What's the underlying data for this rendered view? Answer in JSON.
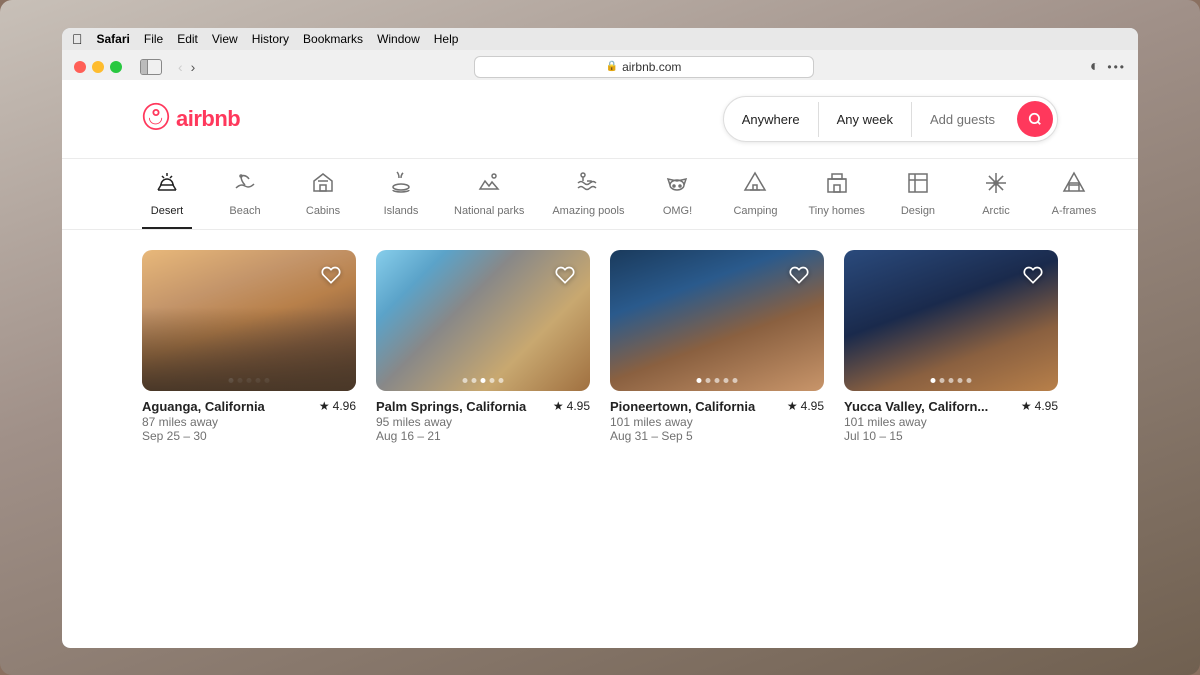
{
  "browser": {
    "url": "airbnb.com",
    "menu_items": [
      "Safari",
      "File",
      "Edit",
      "View",
      "History",
      "Bookmarks",
      "Window",
      "Help"
    ]
  },
  "header": {
    "logo_text": "airbnb",
    "search": {
      "location": "Anywhere",
      "dates": "Any week",
      "guests": "Add guests"
    }
  },
  "categories": [
    {
      "id": "desert",
      "label": "Desert",
      "icon": "🌵",
      "active": true
    },
    {
      "id": "beach",
      "label": "Beach",
      "icon": "⛱",
      "active": false
    },
    {
      "id": "cabins",
      "label": "Cabins",
      "icon": "🏠",
      "active": false
    },
    {
      "id": "islands",
      "label": "Islands",
      "icon": "🏝",
      "active": false
    },
    {
      "id": "national-parks",
      "label": "National parks",
      "icon": "⛺",
      "active": false
    },
    {
      "id": "amazing-pools",
      "label": "Amazing pools",
      "icon": "🏊",
      "active": false
    },
    {
      "id": "omg",
      "label": "OMG!",
      "icon": "🛸",
      "active": false
    },
    {
      "id": "camping",
      "label": "Camping",
      "icon": "🏕",
      "active": false
    },
    {
      "id": "tiny-homes",
      "label": "Tiny homes",
      "icon": "📊",
      "active": false
    },
    {
      "id": "design",
      "label": "Design",
      "icon": "🏛",
      "active": false
    },
    {
      "id": "arctic",
      "label": "Arctic",
      "icon": "❄",
      "active": false
    },
    {
      "id": "a-frames",
      "label": "A-frames",
      "icon": "🔺",
      "active": false
    }
  ],
  "listings": [
    {
      "id": 1,
      "location": "Aguanga, California",
      "distance": "87 miles away",
      "dates": "Sep 25 – 30",
      "rating": "4.96",
      "image_type": "desert1",
      "dots": 5,
      "active_dot": 0
    },
    {
      "id": 2,
      "location": "Palm Springs, California",
      "distance": "95 miles away",
      "dates": "Aug 16 – 21",
      "rating": "4.95",
      "image_type": "desert2",
      "dots": 5,
      "active_dot": 2
    },
    {
      "id": 3,
      "location": "Pioneertown, California",
      "distance": "101 miles away",
      "dates": "Aug 31 – Sep 5",
      "rating": "4.95",
      "image_type": "desert3",
      "dots": 5,
      "active_dot": 0
    },
    {
      "id": 4,
      "location": "Yucca Valley, Californ...",
      "distance": "101 miles away",
      "dates": "Jul 10 – 15",
      "rating": "4.95",
      "image_type": "desert4",
      "dots": 5,
      "active_dot": 0
    }
  ]
}
